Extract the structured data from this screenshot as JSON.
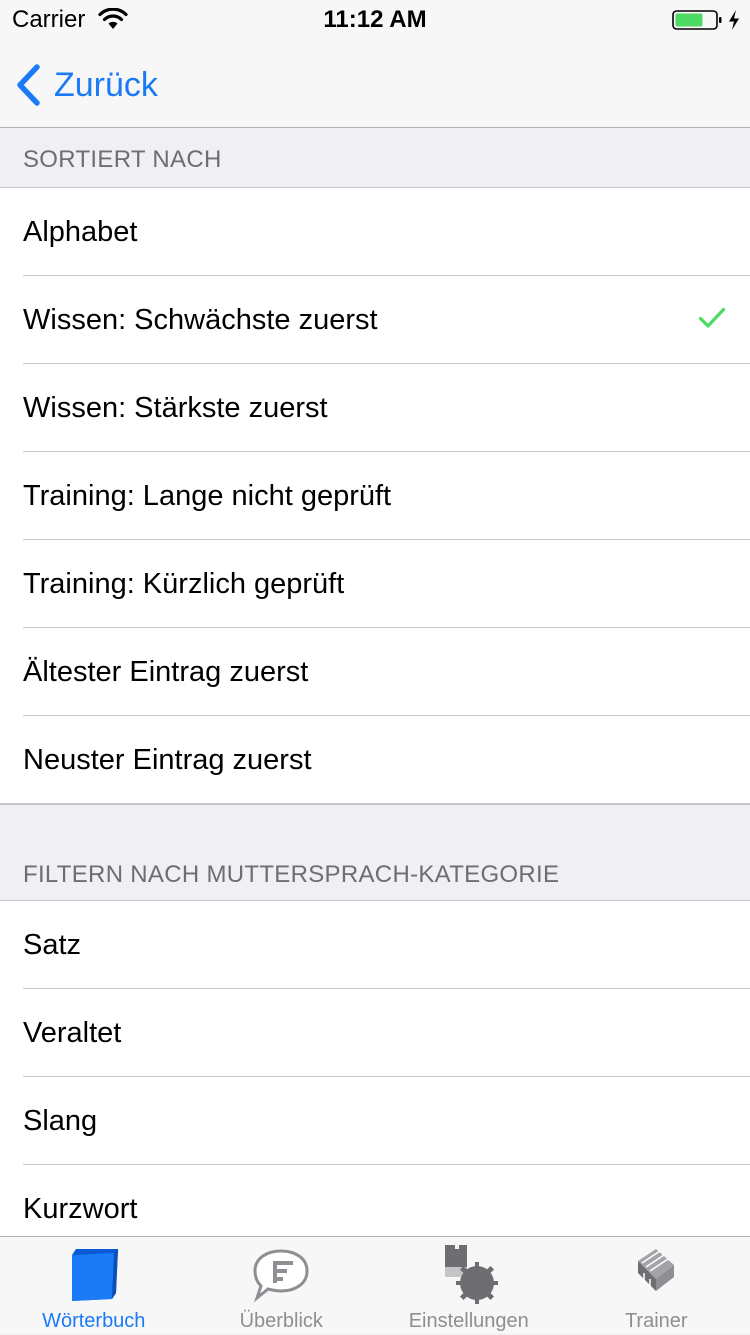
{
  "status_bar": {
    "carrier": "Carrier",
    "time": "11:12 AM",
    "battery_color": "#4cd964"
  },
  "nav": {
    "back_label": "Zurück",
    "back_icon": "chevron-left-icon"
  },
  "sort_section": {
    "header": "SORTIERT NACH",
    "selected_index": 1,
    "check_color": "#4cd964",
    "items": [
      {
        "label": "Alphabet"
      },
      {
        "label": "Wissen: Schwächste zuerst"
      },
      {
        "label": "Wissen: Stärkste zuerst"
      },
      {
        "label": "Training: Lange nicht geprüft"
      },
      {
        "label": "Training: Kürzlich geprüft"
      },
      {
        "label": "Ältester Eintrag zuerst"
      },
      {
        "label": "Neuster Eintrag zuerst"
      }
    ]
  },
  "filter_section": {
    "header": "FILTERN NACH MUTTERSPRACH-KATEGORIE",
    "items": [
      {
        "label": "Satz"
      },
      {
        "label": "Veraltet"
      },
      {
        "label": "Slang"
      },
      {
        "label": "Kurzwort"
      }
    ]
  },
  "tab_bar": {
    "active_color": "#1b7bf6",
    "inactive_color": "#8e8e93",
    "tabs": [
      {
        "label": "Wörterbuch",
        "icon": "book-icon",
        "active": true
      },
      {
        "label": "Überblick",
        "icon": "speech-bubble-chart-icon",
        "active": false
      },
      {
        "label": "Einstellungen",
        "icon": "gears-icon",
        "active": false
      },
      {
        "label": "Trainer",
        "icon": "flashcards-icon",
        "active": false
      }
    ]
  }
}
